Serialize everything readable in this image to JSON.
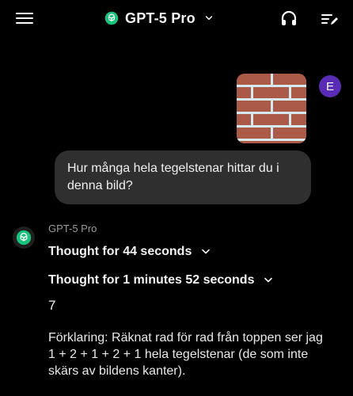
{
  "header": {
    "model_label": "GPT-5 Pro",
    "icons": {
      "menu": "menu-icon",
      "logo": "openai-logo",
      "chevron": "chevron-down-icon",
      "headset": "headset-icon",
      "compose": "compose-icon"
    }
  },
  "user": {
    "avatar_letter": "E",
    "message": "Hur många hela tegelstenar hittar du i denna bild?"
  },
  "assistant": {
    "name": "GPT-5 Pro",
    "thoughts": [
      {
        "label": "Thought for 44 seconds"
      },
      {
        "label": "Thought for 1 minutes 52 seconds"
      }
    ],
    "answer": "7",
    "explanation": "Förklaring: Räknat rad för rad från toppen ser jag 1 + 2 + 1 + 2 + 1 hela tegelstenar (de som inte skärs av bildens kanter)."
  },
  "colors": {
    "background": "#000000",
    "bubble": "#2f2f2f",
    "avatar": "#5a2bb4",
    "brand_green": "#19c37d",
    "brick": "#aa5a46",
    "mortar": "#d7e9f0"
  }
}
